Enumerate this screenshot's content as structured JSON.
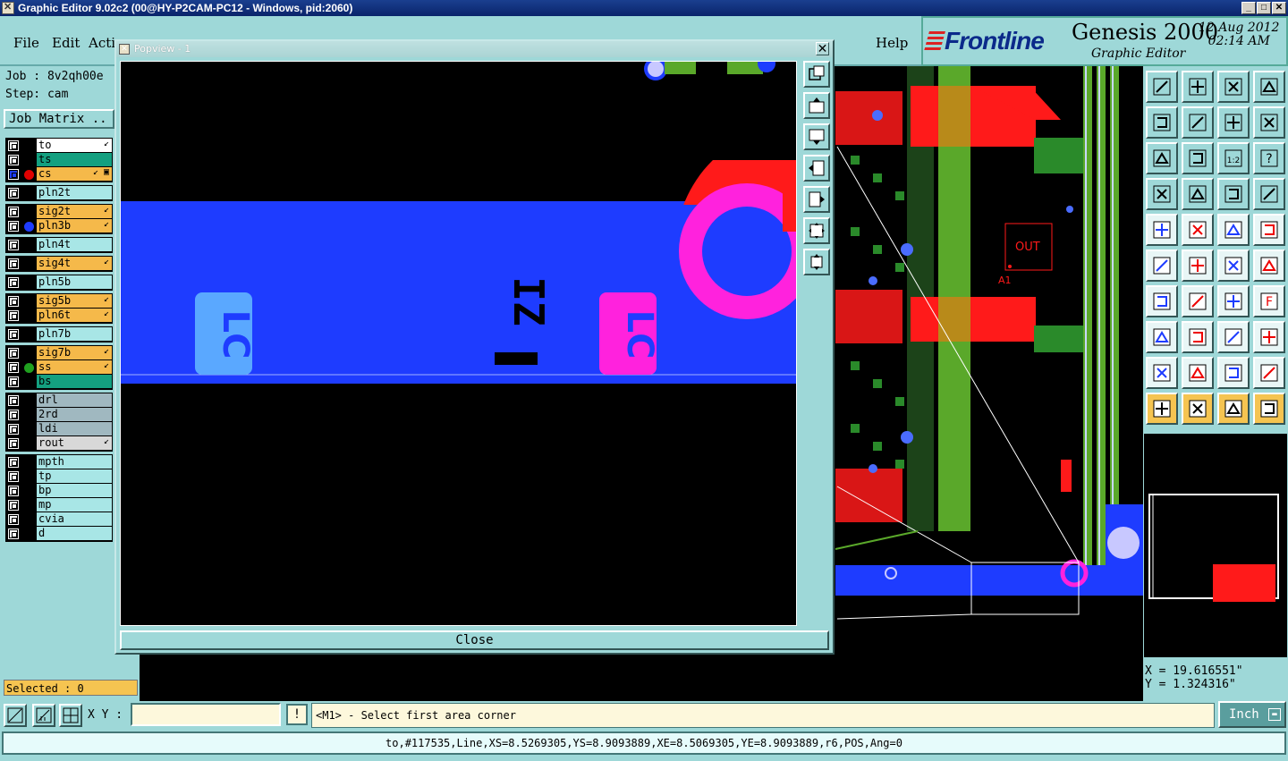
{
  "window": {
    "title": "Graphic Editor 9.02c2 (00@HY-P2CAM-PC12 - Windows, pid:2060)",
    "buttons": [
      "_",
      "□",
      "✕"
    ]
  },
  "menu": {
    "file": "File",
    "edit": "Edit",
    "actions": "Acti",
    "help": "Help"
  },
  "brand": {
    "logo": "Frontline",
    "product": "Genesis 2000",
    "subtitle": "Graphic Editor",
    "date": "12 Aug 2012",
    "time": "02:14 AM"
  },
  "job": {
    "job_line": "Job : 8v2qh00e",
    "step_line": "Step: cam",
    "job_matrix": "Job Matrix .."
  },
  "layer_groups": [
    [
      {
        "name": "to",
        "bg": "#ffffff",
        "pen": "↙"
      },
      {
        "name": "ts",
        "bg": "#14a080",
        "pen": ""
      },
      {
        "name": "cs",
        "bg": "#f5b94a",
        "pen": "↙ ▣",
        "dot": "#e00000",
        "selected": true
      }
    ],
    [
      {
        "name": "pln2t",
        "bg": "#a8e6e6",
        "pen": ""
      }
    ],
    [
      {
        "name": "sig2t",
        "bg": "#f5b94a",
        "pen": "↙"
      },
      {
        "name": "pln3b",
        "bg": "#f5b94a",
        "pen": "↙",
        "dot": "#1e3cff"
      }
    ],
    [
      {
        "name": "pln4t",
        "bg": "#a8e6e6",
        "pen": ""
      }
    ],
    [
      {
        "name": "sig4t",
        "bg": "#f5b94a",
        "pen": "↙"
      }
    ],
    [
      {
        "name": "pln5b",
        "bg": "#a8e6e6",
        "pen": ""
      }
    ],
    [
      {
        "name": "sig5b",
        "bg": "#f5b94a",
        "pen": "↙"
      },
      {
        "name": "pln6t",
        "bg": "#f5b94a",
        "pen": "↙"
      }
    ],
    [
      {
        "name": "pln7b",
        "bg": "#a8e6e6",
        "pen": ""
      }
    ],
    [
      {
        "name": "sig7b",
        "bg": "#f5b94a",
        "pen": "↙"
      },
      {
        "name": "ss",
        "bg": "#f5b94a",
        "pen": "↙",
        "dot": "#20a020"
      },
      {
        "name": "bs",
        "bg": "#14a080",
        "pen": ""
      }
    ],
    [
      {
        "name": "drl",
        "bg": "#a0b8c0",
        "pen": ""
      },
      {
        "name": "2rd",
        "bg": "#a0b8c0",
        "pen": ""
      },
      {
        "name": "ldi",
        "bg": "#a0b8c0",
        "pen": ""
      },
      {
        "name": "rout",
        "bg": "#d8d8d8",
        "pen": "↙"
      }
    ],
    [
      {
        "name": "mpth",
        "bg": "#a8e6e6",
        "pen": ""
      },
      {
        "name": "tp",
        "bg": "#a8e6e6",
        "pen": ""
      },
      {
        "name": "bp",
        "bg": "#a8e6e6",
        "pen": ""
      },
      {
        "name": "mp",
        "bg": "#a8e6e6",
        "pen": ""
      },
      {
        "name": "cvia",
        "bg": "#a8e6e6",
        "pen": ""
      },
      {
        "name": "d",
        "bg": "#a8e6e6",
        "pen": ""
      }
    ]
  ],
  "selected_status": "Selected : 0",
  "popview": {
    "title": "Popview - 1",
    "close_label": "Close",
    "silk_labels": [
      "LC",
      "IZ",
      "LC"
    ]
  },
  "canvas": {
    "out_label": "OUT",
    "a1_label": "A1"
  },
  "coords": {
    "x": "X  =  19.616551\"",
    "y": "Y  =  1.324316\""
  },
  "bottom": {
    "xy_label": "X Y :",
    "xy_value": "",
    "bang": "!",
    "prompt": "<M1> - Select first area corner",
    "units": "Inch",
    "status": "to,#117535,Line,XS=8.5269305,YS=8.9093889,XE=8.5069305,YE=8.9093889,r6,POS,Ang=0"
  },
  "colors": {
    "layer_blue": "#1e3cff",
    "layer_red": "#ff1a1a",
    "layer_magenta": "#ff22dd",
    "layer_green": "#5aa82a",
    "panel": "#9ed8d8"
  }
}
